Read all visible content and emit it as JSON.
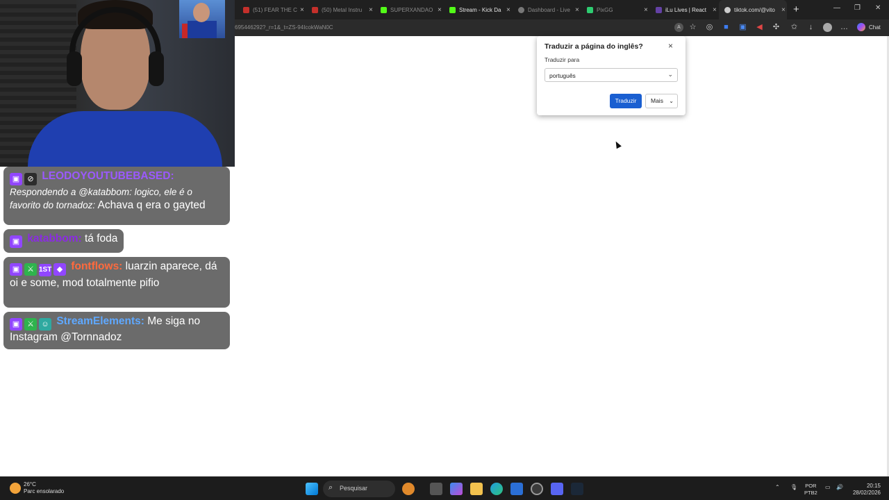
{
  "browser": {
    "tabs": [
      {
        "label": "(51) FEAR THE CI",
        "color": "#c4302b"
      },
      {
        "label": "(50) Metal Instru",
        "color": "#c4302b"
      },
      {
        "label": "SUPERXANDAO",
        "color": "#53fc18"
      },
      {
        "label": "Stream - Kick Da",
        "color": "#53fc18"
      },
      {
        "label": "Dashboard - Live",
        "color": "#777777"
      },
      {
        "label": "PixGG",
        "color": "#2ecc71"
      },
      {
        "label": "iLu Lives | React",
        "color": "#6441a5"
      },
      {
        "label": "tiktok.com/@vito",
        "color": "#cccccc"
      }
    ],
    "new_tab": "+",
    "url": "695446292?_r=1&_t=ZS-94IcokWaN0C",
    "chat_button": "Chat"
  },
  "translate_popup": {
    "title": "Traduzir a página do inglês?",
    "label": "Traduzir para",
    "language": "português",
    "translate_button": "Traduzir",
    "more_button": "Mais",
    "close": "×"
  },
  "chat_messages": [
    {
      "name": "LEODOYOUTUBEBASED:",
      "name_color": "#9b59ff",
      "reply": "Respondendo a @katabbom: logico, ele é o favorito do tornadoz:",
      "text": "Achava q era o gayted"
    },
    {
      "name": "katabbom:",
      "name_color": "#8a2be2",
      "text": "tá foda"
    },
    {
      "name": "fontflows:",
      "name_color": "#ff6a3d",
      "text": "luarzin aparece, dá oi e some, mod totalmente pifio",
      "first_badge": "1ST"
    },
    {
      "name": "StreamElements:",
      "name_color": "#5fa8ff",
      "text": "Me siga no Instagram @Tornnadoz"
    }
  ],
  "taskbar": {
    "temperature": "26°C",
    "weather": "Parc ensolarado",
    "search": "Pesquisar",
    "lang_top": "POR",
    "lang_bottom": "PTB2",
    "time": "20:15",
    "date": "28/02/2026"
  }
}
